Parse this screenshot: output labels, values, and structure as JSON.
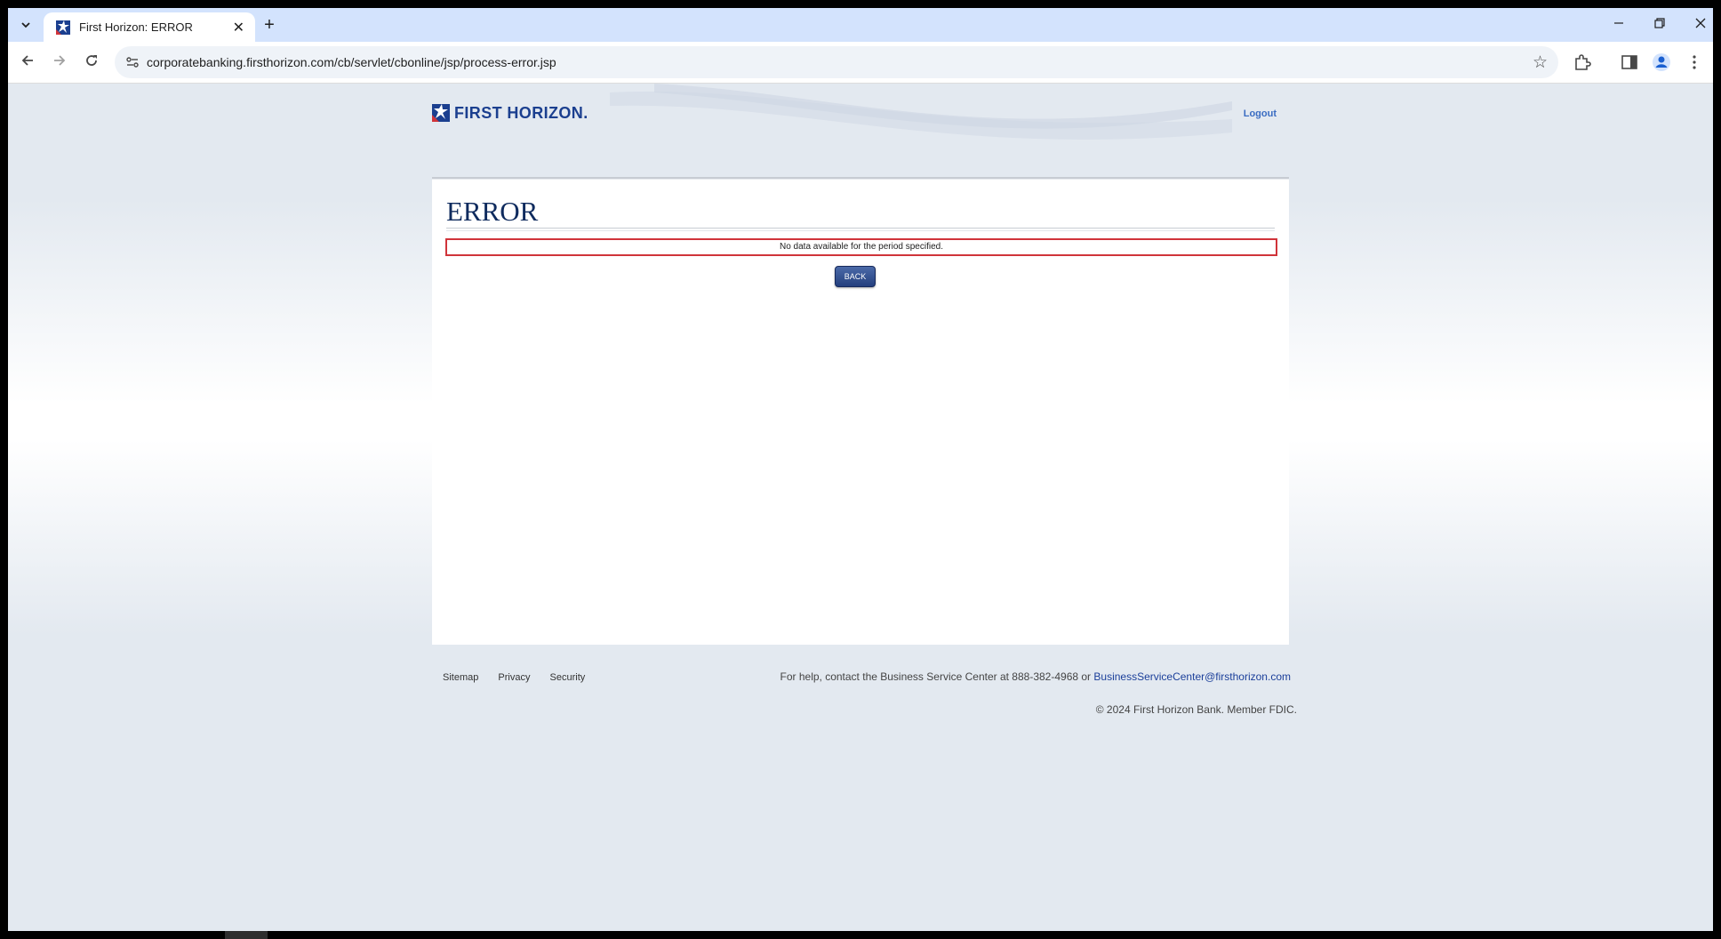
{
  "browser": {
    "tab_title": "First Horizon: ERROR",
    "url": "corporatebanking.firsthorizon.com/cb/servlet/cbonline/jsp/process-error.jsp",
    "new_tab_symbol": "+",
    "close_symbol": "✕"
  },
  "header": {
    "logo_text": "FIRST HORIZON.",
    "logout_label": "Logout"
  },
  "error": {
    "title": "ERROR",
    "message": "No data available for the period specified.",
    "back_label": "BACK"
  },
  "footer": {
    "links": [
      "Sitemap",
      "Privacy",
      "Security"
    ],
    "help_text": "For help, contact the Business Service Center at 888-382-4968 or ",
    "help_email": "BusinessServiceCenter@firsthorizon.com",
    "copyright": "© 2024 First Horizon Bank. Member FDIC."
  },
  "colors": {
    "brand_navy": "#1b3f8f",
    "error_border": "#d0343a"
  }
}
